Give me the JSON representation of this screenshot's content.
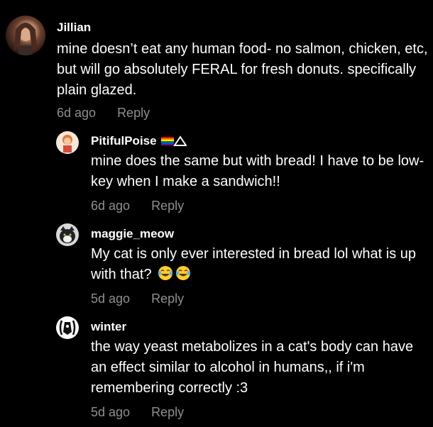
{
  "comments": [
    {
      "username": "Jillian",
      "text": "mine doesn’t eat any human food- no salmon, chicken, etc, but will go absolutely FERAL for fresh donuts. specifically plain glazed.",
      "time": "6d ago",
      "reply_label": "Reply"
    },
    {
      "username": "PitifulPoise",
      "text": "mine does the same but with bread! I have to be low-key when I make a sandwich!!",
      "time": "6d ago",
      "reply_label": "Reply"
    },
    {
      "username": "maggie_meow",
      "text": "My cat is only ever interested in bread lol what is up with that?",
      "time": "5d ago",
      "reply_label": "Reply"
    },
    {
      "username": "winter",
      "text": "the way yeast metabolizes in a cat's body can have an effect similar to alcohol in humans,, if i'm remembering correctly :3",
      "time": "5d ago",
      "reply_label": "Reply"
    }
  ],
  "colors": {
    "background": "#000000",
    "text": "#ffffff",
    "meta": "#8e8e93"
  },
  "icons": {
    "maggie_emoji": "tears-of-joy-emoji",
    "pitiful_badge": "rainbow-flag-triangle-icon"
  }
}
